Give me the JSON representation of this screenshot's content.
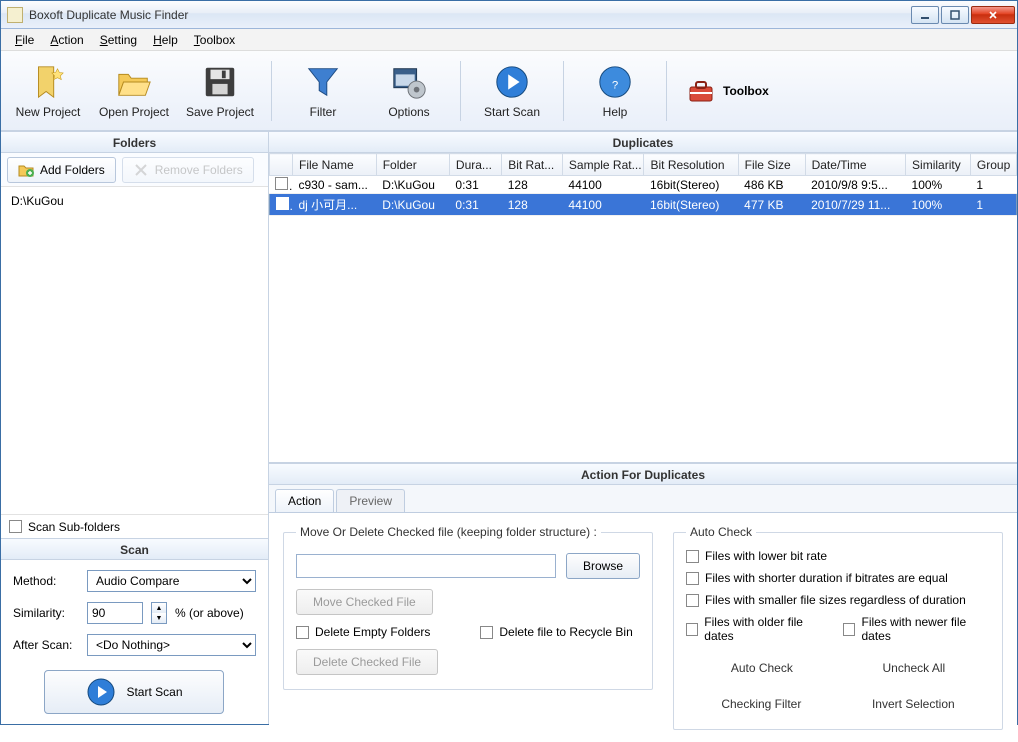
{
  "window": {
    "title": "Boxoft Duplicate Music Finder"
  },
  "menu": {
    "file": "File",
    "action": "Action",
    "setting": "Setting",
    "help": "Help",
    "toolbox": "Toolbox"
  },
  "toolbar": {
    "new_project": "New Project",
    "open_project": "Open Project",
    "save_project": "Save Project",
    "filter": "Filter",
    "options": "Options",
    "start_scan": "Start Scan",
    "help": "Help",
    "toolbox": "Toolbox"
  },
  "panels": {
    "folders": "Folders",
    "scan": "Scan",
    "duplicates": "Duplicates",
    "action_for_dup": "Action For Duplicates"
  },
  "folders": {
    "add": "Add Folders",
    "remove": "Remove Folders",
    "items": [
      "D:\\KuGou"
    ],
    "scan_sub": "Scan Sub-folders"
  },
  "scan": {
    "method_label": "Method:",
    "method_value": "Audio Compare",
    "similarity_label": "Similarity:",
    "similarity_value": "90",
    "similarity_suffix": "% (or above)",
    "after_scan_label": "After Scan:",
    "after_scan_value": "<Do Nothing>",
    "start_scan": "Start Scan"
  },
  "dup_table": {
    "headers": [
      "",
      "File Name",
      "Folder",
      "Dura...",
      "Bit Rat...",
      "Sample Rat...",
      "Bit Resolution",
      "File Size",
      "Date/Time",
      "Similarity",
      "Group"
    ],
    "rows": [
      {
        "selected": false,
        "cells": [
          "c930 - sam...",
          "D:\\KuGou",
          "0:31",
          "128",
          "44100",
          "16bit(Stereo)",
          "486 KB",
          "2010/9/8 9:5...",
          "100%",
          "1"
        ]
      },
      {
        "selected": true,
        "cells": [
          "dj 小可月...",
          "D:\\KuGou",
          "0:31",
          "128",
          "44100",
          "16bit(Stereo)",
          "477 KB",
          "2010/7/29 11...",
          "100%",
          "1"
        ]
      }
    ]
  },
  "action_tabs": {
    "action": "Action",
    "preview": "Preview"
  },
  "actions": {
    "move_delete_legend": "Move Or Delete Checked file (keeping folder structure) :",
    "browse": "Browse",
    "move_checked": "Move Checked File",
    "delete_empty": "Delete Empty Folders",
    "delete_recycle": "Delete file to Recycle Bin",
    "delete_checked": "Delete Checked File",
    "auto_check_legend": "Auto Check",
    "checks": {
      "lower_bitrate": "Files with lower bit rate",
      "shorter_dur": "Files with shorter duration if bitrates are equal",
      "smaller_size": "Files with smaller file sizes regardless of duration",
      "older_dates": "Files with older file dates",
      "newer_dates": "Files with newer file dates"
    },
    "auto_check_btn": "Auto Check",
    "uncheck_all": "Uncheck All",
    "checking_filter": "Checking Filter",
    "invert_sel": "Invert Selection"
  }
}
